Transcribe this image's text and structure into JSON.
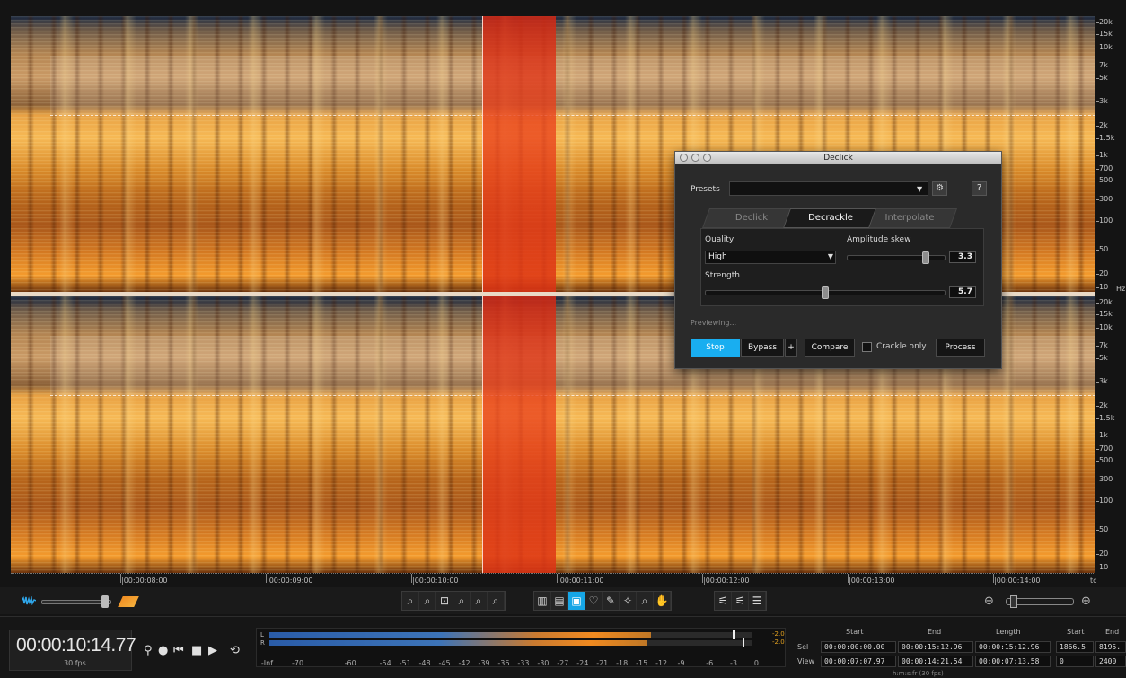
{
  "colors": {
    "accent": "#19aef0",
    "selection_red": "#e0441e",
    "spectrogram_hot": "#f5b24a"
  },
  "frequency_scale": {
    "unit": "Hz",
    "top_channel": [
      "20k",
      "15k",
      "10k",
      "7k",
      "5k",
      "3k",
      "2k",
      "1.5k",
      "1k",
      "700",
      "500",
      "300",
      "100",
      "50",
      "20",
      "10"
    ],
    "bottom_channel": [
      "20k",
      "15k",
      "10k",
      "7k",
      "5k",
      "3k",
      "2k",
      "1.5k",
      "1k",
      "700",
      "500",
      "300",
      "100",
      "50",
      "20",
      "10"
    ]
  },
  "timeline": {
    "labels": [
      "|00:00:08:00",
      "|00:00:09:00",
      "|00:00:10:00",
      "|00:00:11:00",
      "|00:00:12:00",
      "|00:00:13:00",
      "|00:00:14:00"
    ],
    "format": "tc"
  },
  "dialog": {
    "title": "Declick",
    "presets_label": "Presets",
    "presets_value": "",
    "help_label": "?",
    "tabs": [
      {
        "label": "Declick",
        "active": false
      },
      {
        "label": "Decrackle",
        "active": true
      },
      {
        "label": "Interpolate",
        "active": false
      }
    ],
    "quality": {
      "label": "Quality",
      "value": "High"
    },
    "amplitude_skew": {
      "label": "Amplitude skew",
      "value": "3.3",
      "level": 0.8
    },
    "strength": {
      "label": "Strength",
      "value": "5.7",
      "level": 0.5
    },
    "status": "Previewing...",
    "buttons": {
      "stop": "Stop",
      "bypass": "Bypass",
      "plus": "+",
      "compare": "Compare",
      "crackle_only": "Crackle only",
      "process": "Process"
    }
  },
  "transport": {
    "time": "00:00:10:14.77",
    "fps": "30 fps"
  },
  "meter": {
    "channels": [
      "L",
      "R"
    ],
    "peak_values": [
      "-2.0",
      "-2.0"
    ],
    "scale": [
      "-Inf.",
      "-70",
      "-60",
      "-54",
      "-51",
      "-48",
      "-45",
      "-42",
      "-39",
      "-36",
      "-33",
      "-30",
      "-27",
      "-24",
      "-21",
      "-18",
      "-15",
      "-12",
      "-9",
      "-6",
      "-3",
      "0"
    ]
  },
  "selection_table": {
    "headers": [
      "Start",
      "End",
      "Length",
      "Start",
      "End"
    ],
    "rows": [
      {
        "label": "Sel",
        "start": "00:00:00:00.00",
        "end": "00:00:15:12.96",
        "length": "00:00:15:12.96",
        "hz_start": "1866.5",
        "hz_end": "8195."
      },
      {
        "label": "View",
        "start": "00:00:07:07.97",
        "end": "00:00:14:21.54",
        "length": "00:00:07:13.58",
        "hz_start": "0",
        "hz_end": "2400"
      }
    ],
    "footer": "h:m:s:fr (30 fps)"
  }
}
